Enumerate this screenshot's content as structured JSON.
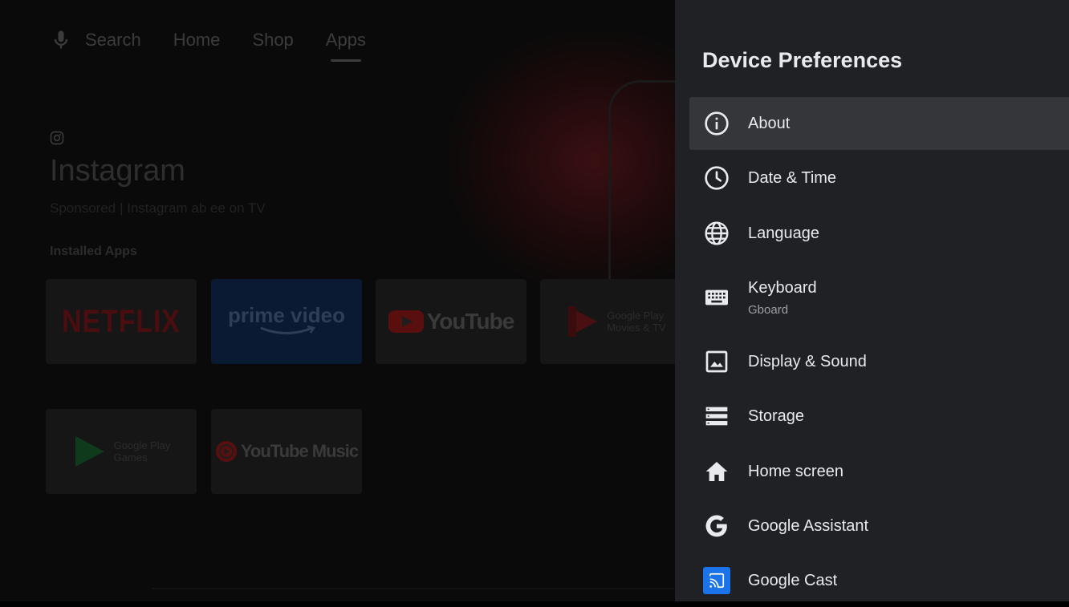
{
  "background": {
    "nav": {
      "search": "Search",
      "home": "Home",
      "shop": "Shop",
      "apps": "Apps",
      "active": "apps"
    },
    "featured": {
      "title": "Instagram",
      "subtitle": "Sponsored | Instagram ab ee on TV"
    },
    "section_label": "Installed Apps",
    "apps": {
      "netflix": "NETFLIX",
      "prime": "prime video",
      "youtube": "YouTube",
      "movies_line1": "Google Play",
      "movies_line2": "Movies & TV",
      "games_line1": "Google Play",
      "games_line2": "Games",
      "ytmusic": "YouTube Music"
    }
  },
  "panel": {
    "title": "Device Preferences",
    "items": [
      {
        "label": "About",
        "icon": "info-icon",
        "focused": true
      },
      {
        "label": "Date & Time",
        "icon": "clock-icon"
      },
      {
        "label": "Language",
        "icon": "globe-icon"
      },
      {
        "label": "Keyboard",
        "sublabel": "Gboard",
        "icon": "keyboard-icon"
      },
      {
        "label": "Display & Sound",
        "icon": "image-icon"
      },
      {
        "label": "Storage",
        "icon": "storage-icon"
      },
      {
        "label": "Home screen",
        "icon": "home-icon"
      },
      {
        "label": "Google Assistant",
        "icon": "google-g-icon"
      },
      {
        "label": "Google Cast",
        "icon": "cast-icon"
      }
    ]
  },
  "colors": {
    "panel_bg": "#202124",
    "focus_bg": "#35363a",
    "cast_blue": "#1a73e8",
    "youtube_red": "#5a0f0f"
  }
}
